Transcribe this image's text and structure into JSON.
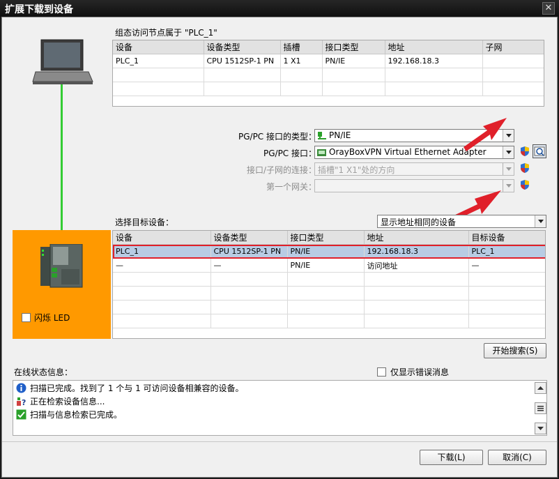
{
  "window": {
    "title": "扩展下载到设备",
    "close_glyph": "✕"
  },
  "config_section": {
    "caption": "组态访问节点属于 \"PLC_1\"",
    "columns": [
      "设备",
      "设备类型",
      "插槽",
      "接口类型",
      "地址",
      "子网"
    ],
    "rows": [
      [
        "PLC_1",
        "CPU 1512SP-1 PN",
        "1 X1",
        "PN/IE",
        "192.168.18.3",
        ""
      ]
    ]
  },
  "pgpc": {
    "type_label": "PG/PC 接口的类型：",
    "type_value": "PN/IE",
    "iface_label": "PG/PC 接口：",
    "iface_value": "OrayBoxVPN Virtual Ethernet Adapter",
    "conn_label": "接口/子网的连接：",
    "conn_value": "插槽\"1 X1\"处的方向",
    "gateway_label": "第一个网关：",
    "gateway_value": ""
  },
  "target": {
    "label": "选择目标设备：",
    "filter_value": "显示地址相同的设备",
    "columns": [
      "设备",
      "设备类型",
      "接口类型",
      "地址",
      "目标设备"
    ],
    "rows": [
      [
        "PLC_1",
        "CPU 1512SP-1 PN",
        "PN/IE",
        "192.168.18.3",
        "PLC_1"
      ],
      [
        "—",
        "—",
        "PN/IE",
        "访问地址",
        "—"
      ]
    ]
  },
  "flash_led_label": "闪烁 LED",
  "start_search_label": "开始搜索(S)",
  "status": {
    "label": "在线状态信息：",
    "only_errors_label": "仅显示错误消息",
    "messages": [
      {
        "icon": "info-icon",
        "text": "扫描已完成。找到了 1 个与 1 可访问设备相兼容的设备。"
      },
      {
        "icon": "search-device-icon",
        "text": "正在检索设备信息..."
      },
      {
        "icon": "check-icon",
        "text": "扫描与信息检索已完成。"
      }
    ]
  },
  "buttons": {
    "load": "下载(L)",
    "cancel": "取消(C)"
  },
  "colors": {
    "accent_orange": "#ff9900",
    "selected_row": "#b8cce4",
    "highlight_red": "#e0202a",
    "link_green": "#33cc33"
  }
}
